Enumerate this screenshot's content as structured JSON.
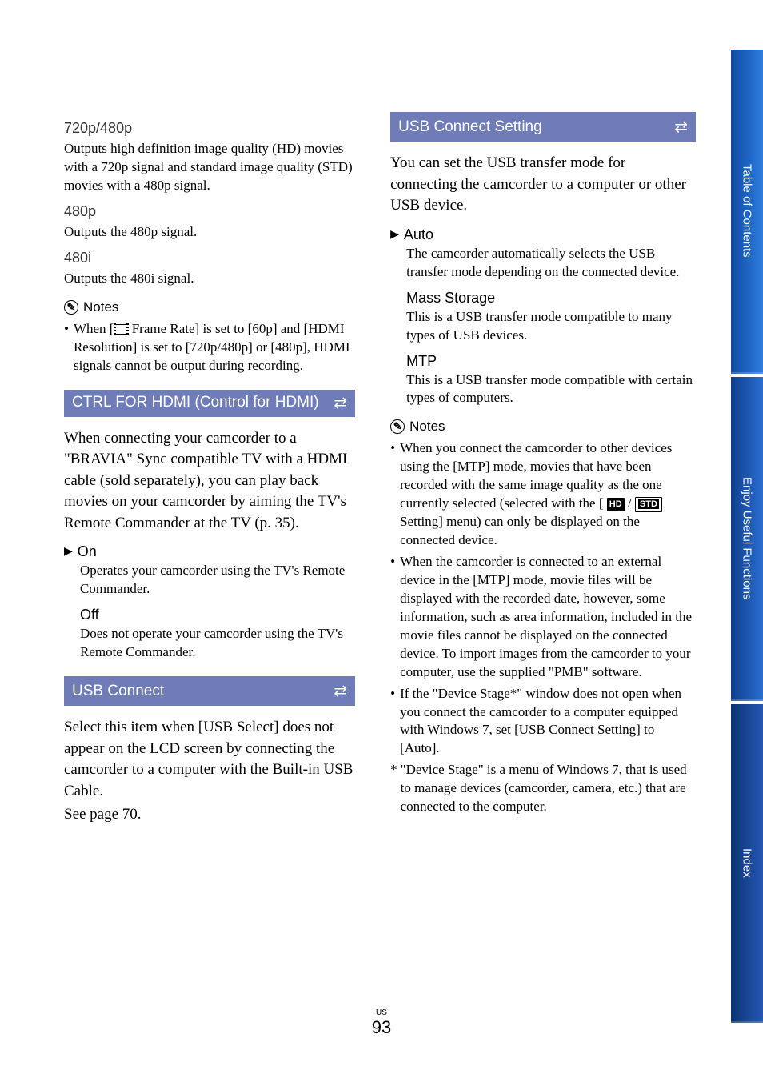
{
  "left": {
    "s1": {
      "h": "720p/480p",
      "p": "Outputs high definition image quality (HD) movies with a 720p signal and standard image quality (STD) movies with a 480p signal."
    },
    "s2": {
      "h": "480p",
      "p": "Outputs the 480p signal."
    },
    "s3": {
      "h": "480i",
      "p": "Outputs the 480i signal."
    },
    "notes_label": "Notes",
    "note1_pre": "When [",
    "note1_post": " Frame Rate] is set to [60p] and [HDMI Resolution] is set to [720p/480p] or [480p], HDMI signals cannot be output during recording.",
    "bar1": "CTRL FOR HDMI (Control for HDMI)",
    "intro1": "When connecting your camcorder to a \"BRAVIA\" Sync compatible TV with a HDMI cable (sold separately), you can play back movies on your camcorder by aiming the TV's Remote Commander at the TV (p. 35).",
    "opt_on": {
      "label": "On",
      "desc": "Operates your camcorder using the TV's Remote Commander."
    },
    "opt_off": {
      "label": "Off",
      "desc": "Does not operate your camcorder using the TV's Remote Commander."
    },
    "bar2": "USB Connect",
    "intro2": "Select this item when [USB Select] does not appear on the LCD screen by connecting the camcorder to a computer with the Built-in USB Cable.",
    "intro2b": "See page 70."
  },
  "right": {
    "bar1": "USB Connect Setting",
    "intro1": "You can set the USB transfer mode for connecting the camcorder to a computer or other USB device.",
    "opt_auto": {
      "label": "Auto",
      "desc": "The camcorder automatically selects the USB transfer mode depending on the connected device."
    },
    "opt_mass": {
      "label": "Mass Storage",
      "desc": "This is a USB transfer mode compatible to many types of USB devices."
    },
    "opt_mtp": {
      "label": "MTP",
      "desc": "This is a USB transfer mode compatible with certain types of computers."
    },
    "notes_label": "Notes",
    "n1_a": "When you connect the camcorder to other devices using the [MTP] mode, movies that have been recorded with the same image quality as the one currently selected (selected with the [ ",
    "n1_b": " / ",
    "n1_c": " Setting] menu) can only be displayed on the connected device.",
    "n2": "When the camcorder is connected to an external device in the [MTP] mode, movie files will be displayed with the recorded date, however, some information, such as area information, included in the movie files cannot be displayed on the connected device. To import images from the camcorder to your computer, use the supplied \"PMB\" software.",
    "n3": "If the \"Device Stage*\" window does not open when you connect the camcorder to a computer equipped with Windows 7, set [USB Connect Setting] to [Auto].",
    "star": "\"Device Stage\" is a menu of Windows 7, that is used to manage devices (camcorder, camera, etc.) that are connected to the computer."
  },
  "tabs": {
    "t1": "Table of Contents",
    "t2": "Enjoy Useful Functions",
    "t3": "Index"
  },
  "page": {
    "region": "US",
    "num": "93"
  },
  "badges": {
    "hd": "HD",
    "std": "STD"
  }
}
